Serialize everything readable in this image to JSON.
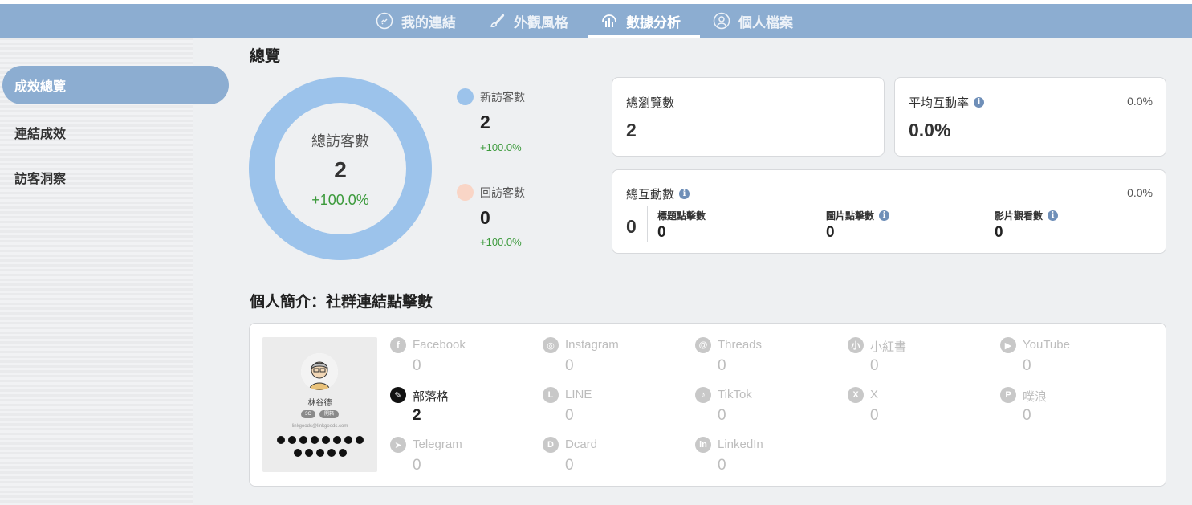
{
  "nav": {
    "tabs": [
      {
        "label": "我的連結",
        "icon": "link-icon"
      },
      {
        "label": "外觀風格",
        "icon": "brush-icon"
      },
      {
        "label": "數據分析",
        "icon": "analytics-icon"
      },
      {
        "label": "個人檔案",
        "icon": "user-icon"
      }
    ],
    "active_tab": "數據分析"
  },
  "sidebar": {
    "items": [
      {
        "label": "成效總覽"
      },
      {
        "label": "連結成效"
      },
      {
        "label": "訪客洞察"
      }
    ],
    "active": "成效總覽"
  },
  "overview": {
    "title": "總覽",
    "donut": {
      "label": "總訪客數",
      "value": "2",
      "change": "+100.0%",
      "new_share": 1.0
    },
    "new_visitors": {
      "label": "新訪客數",
      "value": "2",
      "change": "+100.0%",
      "color": "#9cc3eb"
    },
    "returning_visitors": {
      "label": "回訪客數",
      "value": "0",
      "change": "+100.0%",
      "color": "#f9d5c6"
    }
  },
  "cards": {
    "views": {
      "label": "總瀏覽數",
      "value": "2"
    },
    "avg_rate": {
      "label": "平均互動率",
      "value": "0.0%",
      "pct": "0.0%"
    },
    "interactions": {
      "label": "總互動數",
      "pct": "0.0%",
      "total": "0",
      "title_clicks": {
        "label": "標題點擊數",
        "value": "0"
      },
      "image_clicks": {
        "label": "圖片點擊數",
        "value": "0"
      },
      "video_views": {
        "label": "影片觀看數",
        "value": "0"
      }
    }
  },
  "social": {
    "title": "個人簡介：社群連結點擊數",
    "preview": {
      "name": "林谷德",
      "tags": [
        "3C",
        "開箱"
      ],
      "email": "linkgoods@linkgoods.com"
    },
    "items": [
      {
        "name": "Facebook",
        "value": "0",
        "icon": "facebook-icon",
        "glyph": "f"
      },
      {
        "name": "Instagram",
        "value": "0",
        "icon": "instagram-icon",
        "glyph": "◎"
      },
      {
        "name": "Threads",
        "value": "0",
        "icon": "threads-icon",
        "glyph": "@"
      },
      {
        "name": "小紅書",
        "value": "0",
        "icon": "xiaohongshu-icon",
        "glyph": "小"
      },
      {
        "name": "YouTube",
        "value": "0",
        "icon": "youtube-icon",
        "glyph": "▶"
      },
      {
        "name": "部落格",
        "value": "2",
        "icon": "blog-icon",
        "glyph": "✎"
      },
      {
        "name": "LINE",
        "value": "0",
        "icon": "line-icon",
        "glyph": "L"
      },
      {
        "name": "TikTok",
        "value": "0",
        "icon": "tiktok-icon",
        "glyph": "♪"
      },
      {
        "name": "X",
        "value": "0",
        "icon": "x-icon",
        "glyph": "X"
      },
      {
        "name": "噗浪",
        "value": "0",
        "icon": "plurk-icon",
        "glyph": "P"
      },
      {
        "name": "Telegram",
        "value": "0",
        "icon": "telegram-icon",
        "glyph": "➤"
      },
      {
        "name": "Dcard",
        "value": "0",
        "icon": "dcard-icon",
        "glyph": "D"
      },
      {
        "name": "LinkedIn",
        "value": "0",
        "icon": "linkedin-icon",
        "glyph": "in"
      }
    ]
  },
  "colors": {
    "nav": "#8cadd1",
    "positive": "#3c9a3c",
    "donut_new": "#9cc3eb"
  }
}
